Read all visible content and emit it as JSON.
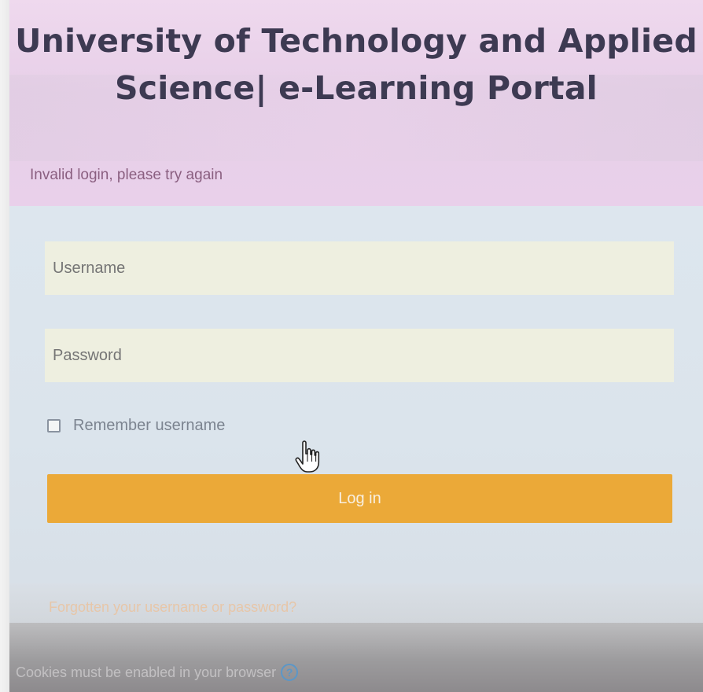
{
  "header": {
    "title_line1": "University of Technology and Applied",
    "title_line2": "Science| e-Learning Portal"
  },
  "alert": {
    "message": "Invalid login, please try again"
  },
  "login_form": {
    "username_placeholder": "Username",
    "password_placeholder": "Password",
    "remember_label": "Remember username",
    "login_button_label": "Log in"
  },
  "links": {
    "forgot": "Forgotten your username or password?"
  },
  "footer": {
    "cookies_notice": "Cookies must be enabled in your browser",
    "help_icon_glyph": "?"
  },
  "icons": {
    "cursor": "hand-pointer-icon",
    "help": "question-circle-icon"
  },
  "colors": {
    "accent_button": "#eba938",
    "title_text": "#3d3a52",
    "error_text": "#8a5f80",
    "header_band": "#e8d0e9",
    "form_panel": "#dbe4ec",
    "field_bg": "#eeefe0",
    "help_icon": "#5b97c8"
  }
}
